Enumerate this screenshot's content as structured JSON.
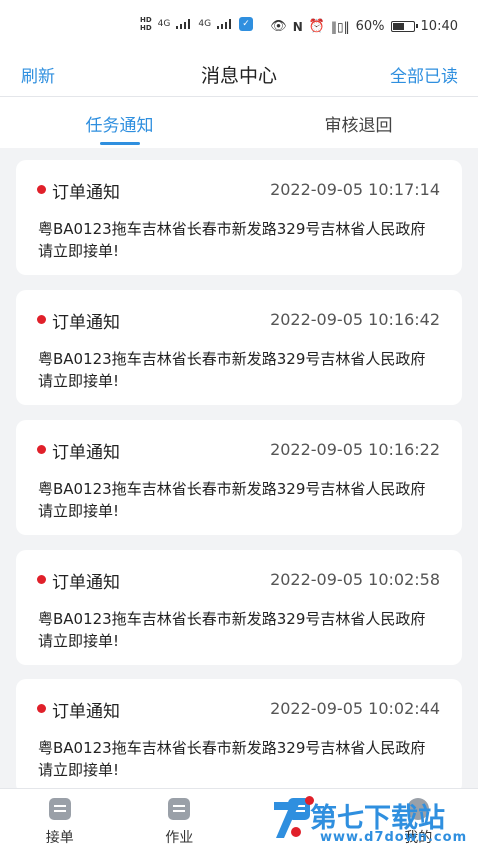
{
  "status_bar": {
    "hd_top": "HD",
    "hd_bottom": "HD",
    "net1": "4G",
    "net2": "4G",
    "battery_text": "60%",
    "time": "10:40",
    "icons": [
      "eye-icon",
      "nfc-icon",
      "alarm-icon",
      "vibrate-icon"
    ]
  },
  "header": {
    "refresh_label": "刷新",
    "title": "消息中心",
    "mark_all_label": "全部已读"
  },
  "tabs": [
    {
      "label": "任务通知",
      "active": true
    },
    {
      "label": "审核退回",
      "active": false
    }
  ],
  "messages": [
    {
      "title": "订单通知",
      "time": "2022-09-05 10:17:14",
      "body": "粤BA0123拖车吉林省长春市新发路329号吉林省人民政府 请立即接单!"
    },
    {
      "title": "订单通知",
      "time": "2022-09-05 10:16:42",
      "body": "粤BA0123拖车吉林省长春市新发路329号吉林省人民政府 请立即接单!"
    },
    {
      "title": "订单通知",
      "time": "2022-09-05 10:16:22",
      "body": "粤BA0123拖车吉林省长春市新发路329号吉林省人民政府 请立即接单!"
    },
    {
      "title": "订单通知",
      "time": "2022-09-05 10:02:58",
      "body": "粤BA0123拖车吉林省长春市新发路329号吉林省人民政府 请立即接单!"
    },
    {
      "title": "订单通知",
      "time": "2022-09-05 10:02:44",
      "body": "粤BA0123拖车吉林省长春市新发路329号吉林省人民政府 请立即接单!"
    }
  ],
  "tabbar": [
    {
      "label": "接单",
      "icon": "order-icon"
    },
    {
      "label": "作业",
      "icon": "work-icon"
    },
    {
      "label": "",
      "icon": "message-icon"
    },
    {
      "label": "我的",
      "icon": "profile-icon"
    }
  ],
  "watermark": {
    "text": "第七下载站",
    "url": "www.d7down.com"
  },
  "colors": {
    "accent": "#2f8fdf",
    "unread_dot": "#e0202a",
    "background": "#f2f3f5"
  }
}
